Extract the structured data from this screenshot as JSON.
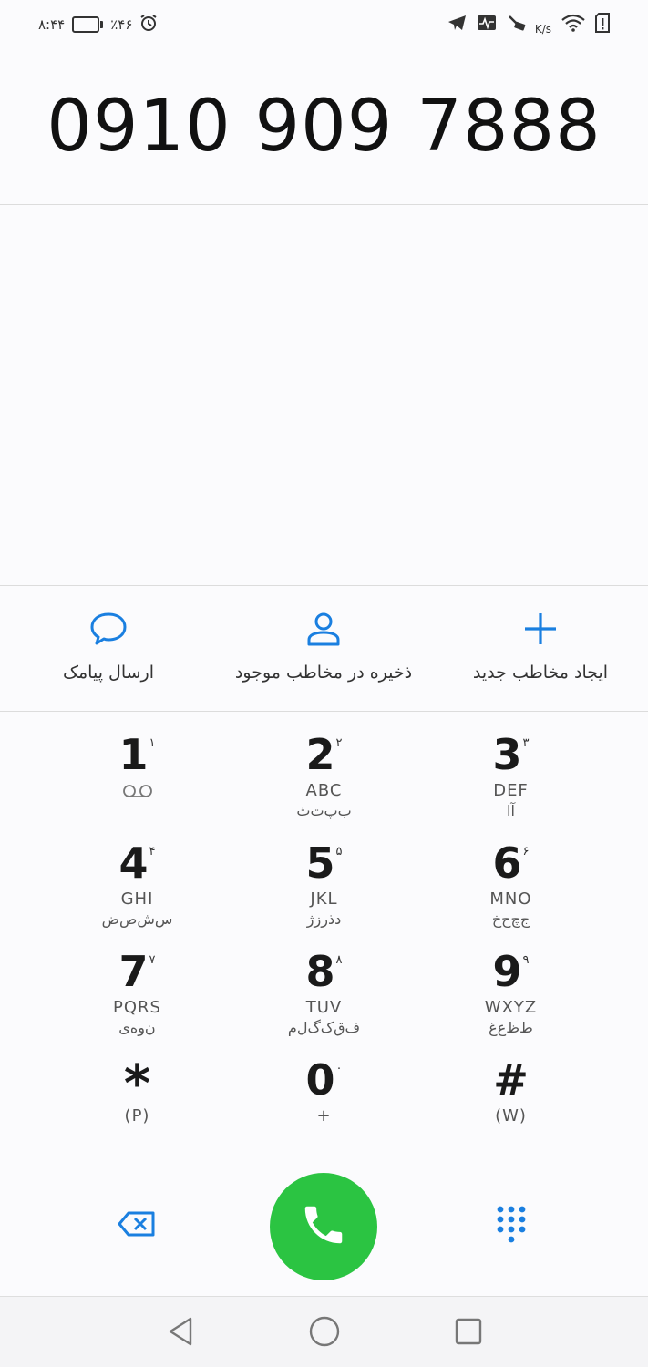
{
  "status_bar": {
    "time": "۸:۴۴",
    "battery_percent": "٪۴۶",
    "battery_level": 0.46,
    "speed_unit": "K/s",
    "left_icons": [
      "battery-icon",
      "alarm-icon"
    ],
    "right_icons": [
      "telegram-icon",
      "activity-icon",
      "vpn-icon",
      "wifi-icon",
      "sim-alert-icon"
    ]
  },
  "dialer": {
    "number": "0910 909 7888"
  },
  "actions": {
    "send_sms": "ارسال پیامک",
    "save_existing": "ذخیره در مخاطب موجود",
    "new_contact": "ایجاد مخاطب جدید"
  },
  "keypad": [
    {
      "digit": "1",
      "sup": "۱",
      "letters": "",
      "fa": "",
      "voicemail": true
    },
    {
      "digit": "2",
      "sup": "۲",
      "letters": "ABC",
      "fa": "ب‌پ‌ت‌ث"
    },
    {
      "digit": "3",
      "sup": "۳",
      "letters": "DEF",
      "fa": "آ‌ا"
    },
    {
      "digit": "4",
      "sup": "۴",
      "letters": "GHI",
      "fa": "س‌ش‌ص‌ض"
    },
    {
      "digit": "5",
      "sup": "۵",
      "letters": "JKL",
      "fa": "د‌ذ‌ر‌ز‌ژ"
    },
    {
      "digit": "6",
      "sup": "۶",
      "letters": "MNO",
      "fa": "ج‌چ‌ح‌خ"
    },
    {
      "digit": "7",
      "sup": "۷",
      "letters": "PQRS",
      "fa": "ن‌و‌ه‌ی"
    },
    {
      "digit": "8",
      "sup": "۸",
      "letters": "TUV",
      "fa": "ف‌ق‌ک‌گ‌ل‌م"
    },
    {
      "digit": "9",
      "sup": "۹",
      "letters": "WXYZ",
      "fa": "ط‌ظ‌ع‌غ"
    },
    {
      "digit": "*",
      "sup": "",
      "letters": "(P)",
      "fa": ""
    },
    {
      "digit": "0",
      "sup": "۰",
      "letters": "+",
      "fa": ""
    },
    {
      "digit": "#",
      "sup": "",
      "letters": "(W)",
      "fa": ""
    }
  ],
  "colors": {
    "accent": "#1a7fe0",
    "call_green": "#2bc442"
  }
}
